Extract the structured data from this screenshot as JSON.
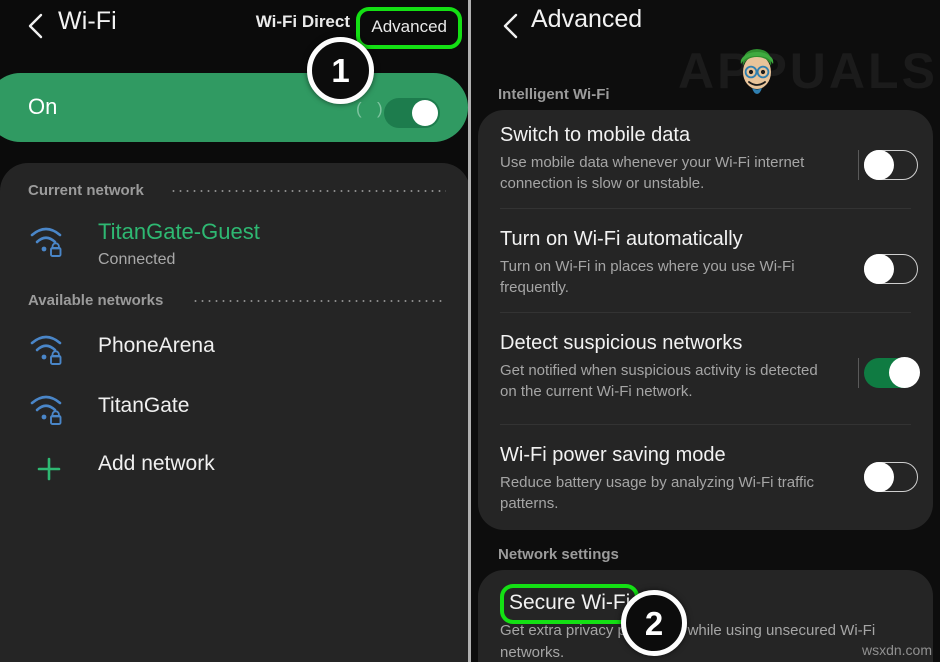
{
  "colors": {
    "accent_green": "#2eb872",
    "banner_green": "#309a62",
    "highlight_green": "#14e014",
    "toggle_on_green": "#0f7b42",
    "card_bg": "#252525",
    "page_bg": "#0b0b0b",
    "wifi_icon_blue": "#4a86c8"
  },
  "left_panel": {
    "header": {
      "back_icon": "back-chevron-icon",
      "title": "Wi-Fi",
      "wifi_direct_label": "Wi-Fi Direct",
      "advanced_label": "Advanced"
    },
    "banner": {
      "state_label": "On",
      "paren_left": "(",
      "paren_right": ")",
      "switch_state": "on"
    },
    "sections": [
      {
        "heading": "Current network"
      },
      {
        "heading": "Available networks"
      }
    ],
    "current_network": {
      "icon": "wifi-lock-icon",
      "name": "TitanGate-Guest",
      "status": "Connected"
    },
    "available_networks": [
      {
        "icon": "wifi-lock-icon",
        "name": "PhoneArena"
      },
      {
        "icon": "wifi-lock-icon",
        "name": "TitanGate"
      }
    ],
    "add_network": {
      "icon": "plus-icon",
      "label": "Add network"
    }
  },
  "right_panel": {
    "header": {
      "back_icon": "back-chevron-icon",
      "title": "Advanced"
    },
    "watermark": "APPUALS",
    "sections": [
      {
        "heading": "Intelligent Wi-Fi"
      },
      {
        "heading": "Network settings"
      }
    ],
    "settings": [
      {
        "title": "Switch to mobile data",
        "description": "Use mobile data whenever your Wi-Fi internet connection is slow or unstable.",
        "toggle": "off"
      },
      {
        "title": "Turn on Wi-Fi automatically",
        "description": "Turn on Wi-Fi in places where you use Wi-Fi frequently.",
        "toggle": "off"
      },
      {
        "title": "Detect suspicious networks",
        "description": "Get notified when suspicious activity is detected on the current Wi-Fi network.",
        "toggle": "on"
      },
      {
        "title": "Wi-Fi power saving mode",
        "description": "Reduce battery usage by analyzing Wi-Fi traffic patterns.",
        "toggle": "off"
      }
    ],
    "secure_wifi": {
      "title": "Secure Wi-Fi",
      "description": "Get extra privacy protection while using unsecured Wi-Fi networks."
    }
  },
  "annotations": {
    "badge_1": "1",
    "badge_2": "2",
    "site_watermark": "wsxdn.com"
  }
}
